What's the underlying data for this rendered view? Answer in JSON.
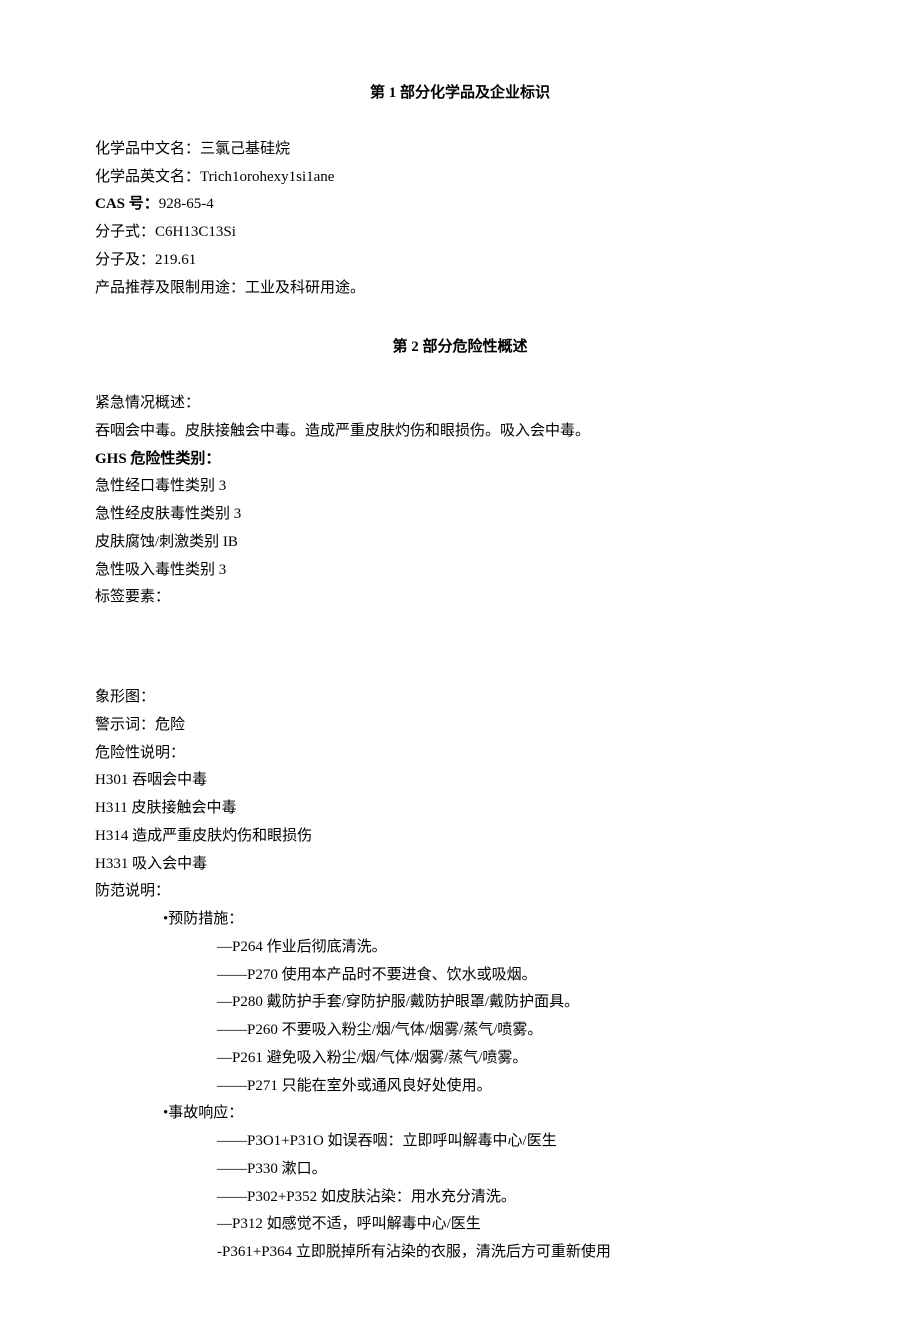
{
  "section1": {
    "title": "第 1 部分化学品及企业标识",
    "name_cn_label": "化学品中文名：",
    "name_cn": "三氯己基硅烷",
    "name_en_label": "化学品英文名：",
    "name_en": "Trich1orohexy1si1ane",
    "cas_label": "CAS 号：",
    "cas": "928-65-4",
    "formula_label": "分子式：",
    "formula": "C6H13C13Si",
    "mw_label": "分子及：",
    "mw": "219.61",
    "use_label": "产品推荐及限制用途：",
    "use": "工业及科研用途。"
  },
  "section2": {
    "title": "第 2 部分危险性概述",
    "emergency_label": "紧急情况概述：",
    "emergency_text": "吞咽会中毒。皮肤接触会中毒。造成严重皮肤灼伤和眼损伤。吸入会中毒。",
    "ghs_label": "GHS 危险性类别：",
    "ghs_items": [
      "急性经口毒性类别 3",
      "急性经皮肤毒性类别 3",
      "皮肤腐蚀/刺激类别 IB",
      "急性吸入毒性类别 3"
    ],
    "label_elements": "标签要素：",
    "pictogram_label": "象形图：",
    "signal_label": "警示词：",
    "signal_word": "危险",
    "hazard_label": "危险性说明：",
    "hazard_items": [
      "H301 吞咽会中毒",
      "H311 皮肤接触会中毒",
      "H314 造成严重皮肤灼伤和眼损伤",
      "H331 吸入会中毒"
    ],
    "precaution_label": "防范说明：",
    "prevention_label": "•预防措施：",
    "prevention_items": [
      "—P264 作业后彻底清洗。",
      "——P270 使用本产品时不要进食、饮水或吸烟。",
      "—P280 戴防护手套/穿防护服/戴防护眼罩/戴防护面具。",
      "——P260 不要吸入粉尘/烟/气体/烟雾/蒸气/喷雾。",
      "—P261 避免吸入粉尘/烟/气体/烟雾/蒸气/喷雾。",
      "——P271 只能在室外或通风良好处使用。"
    ],
    "response_label": "•事故响应：",
    "response_items": [
      "——P3O1+P31O 如误吞咽：立即呼叫解毒中心/医生",
      "——P330 漱口。",
      "——P302+P352 如皮肤沾染：用水充分清洗。",
      "—P312 如感觉不适，呼叫解毒中心/医生",
      "-P361+P364 立即脱掉所有沾染的衣服，清洗后方可重新使用"
    ]
  }
}
